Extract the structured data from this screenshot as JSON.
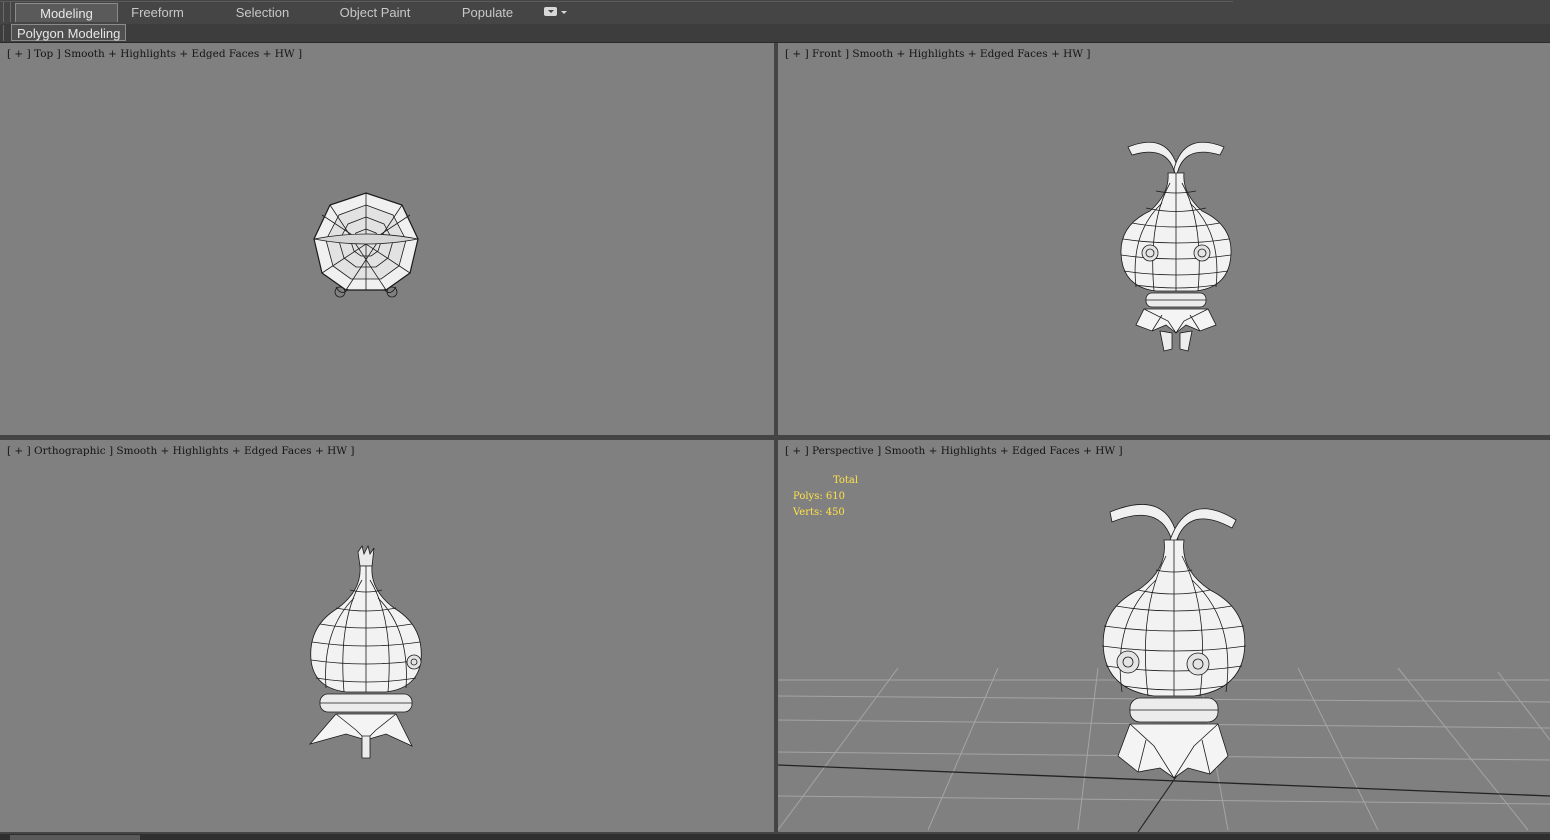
{
  "ribbon": {
    "tabs": [
      "Modeling",
      "Freeform",
      "Selection",
      "Object Paint",
      "Populate"
    ],
    "active_tab": "Modeling",
    "subpanel_label": "Polygon Modeling"
  },
  "viewports": [
    {
      "label": "[ + ] Top ] Smooth + Highlights + Edged Faces + HW ]"
    },
    {
      "label": "[ + ] Front ] Smooth + Highlights + Edged Faces + HW ]"
    },
    {
      "label": "[ + ] Orthographic ] Smooth + Highlights + Edged Faces + HW ]"
    },
    {
      "label": "[ + ] Perspective ] Smooth + Highlights + Edged Faces + HW ]"
    }
  ],
  "stats": {
    "title": "Total",
    "polys": "Polys: 610",
    "verts": "Verts: 450",
    "color": "#ffe14a"
  },
  "colors": {
    "viewport_bg": "#808080",
    "border": "#444444",
    "mesh_fill": "#f2f2f2",
    "wire": "#1a1a1a"
  }
}
